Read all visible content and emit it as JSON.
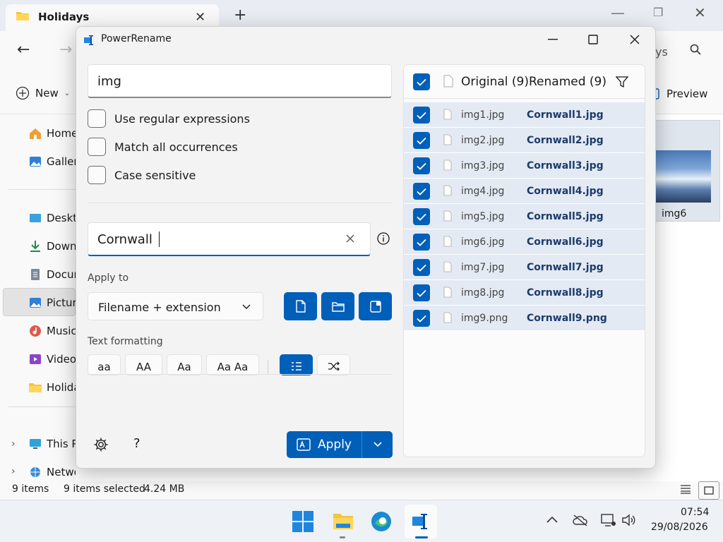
{
  "explorer": {
    "tab_title": "Holidays",
    "new_label": "New",
    "search_hint": "ys",
    "preview_label": "Preview",
    "sidebar": [
      {
        "label": "Home",
        "icon": "home-icon"
      },
      {
        "label": "Gallery",
        "icon": "gallery-icon"
      },
      {
        "label": "Desktop",
        "icon": "desktop-icon"
      },
      {
        "label": "Downloads",
        "icon": "downloads-icon"
      },
      {
        "label": "Documents",
        "icon": "documents-icon"
      },
      {
        "label": "Pictures",
        "icon": "pictures-icon"
      },
      {
        "label": "Music",
        "icon": "music-icon"
      },
      {
        "label": "Videos",
        "icon": "videos-icon"
      },
      {
        "label": "Holidays",
        "icon": "folder-icon"
      },
      {
        "label": "This PC",
        "icon": "pc-icon"
      },
      {
        "label": "Network",
        "icon": "network-icon"
      }
    ],
    "thumb_label": "img6",
    "status": {
      "items": "9 items",
      "selected": "9 items selected",
      "size": "4.24 MB"
    }
  },
  "taskbar": {
    "time": "07:54",
    "date": "29/08/2026"
  },
  "powerrename": {
    "title": "PowerRename",
    "search_value": "img",
    "options": [
      {
        "label": "Use regular expressions",
        "checked": false
      },
      {
        "label": "Match all occurrences",
        "checked": false
      },
      {
        "label": "Case sensitive",
        "checked": false
      }
    ],
    "replace_value": "Cornwall",
    "apply_to_label": "Apply to",
    "apply_to_value": "Filename + extension",
    "text_formatting_label": "Text formatting",
    "format_buttons": [
      "aa",
      "AA",
      "Aa",
      "Aa Aa"
    ],
    "apply_label": "Apply",
    "help_label": "?",
    "list_header": {
      "original": "Original (9)",
      "renamed": "Renamed (9)"
    },
    "files": [
      {
        "original": "img1.jpg",
        "renamed": "Cornwall1.jpg"
      },
      {
        "original": "img2.jpg",
        "renamed": "Cornwall2.jpg"
      },
      {
        "original": "img3.jpg",
        "renamed": "Cornwall3.jpg"
      },
      {
        "original": "img4.jpg",
        "renamed": "Cornwall4.jpg"
      },
      {
        "original": "img5.jpg",
        "renamed": "Cornwall5.jpg"
      },
      {
        "original": "img6.jpg",
        "renamed": "Cornwall6.jpg"
      },
      {
        "original": "img7.jpg",
        "renamed": "Cornwall7.jpg"
      },
      {
        "original": "img8.jpg",
        "renamed": "Cornwall8.jpg"
      },
      {
        "original": "img9.png",
        "renamed": "Cornwall9.png"
      }
    ],
    "accent_color": "#005fb8"
  }
}
